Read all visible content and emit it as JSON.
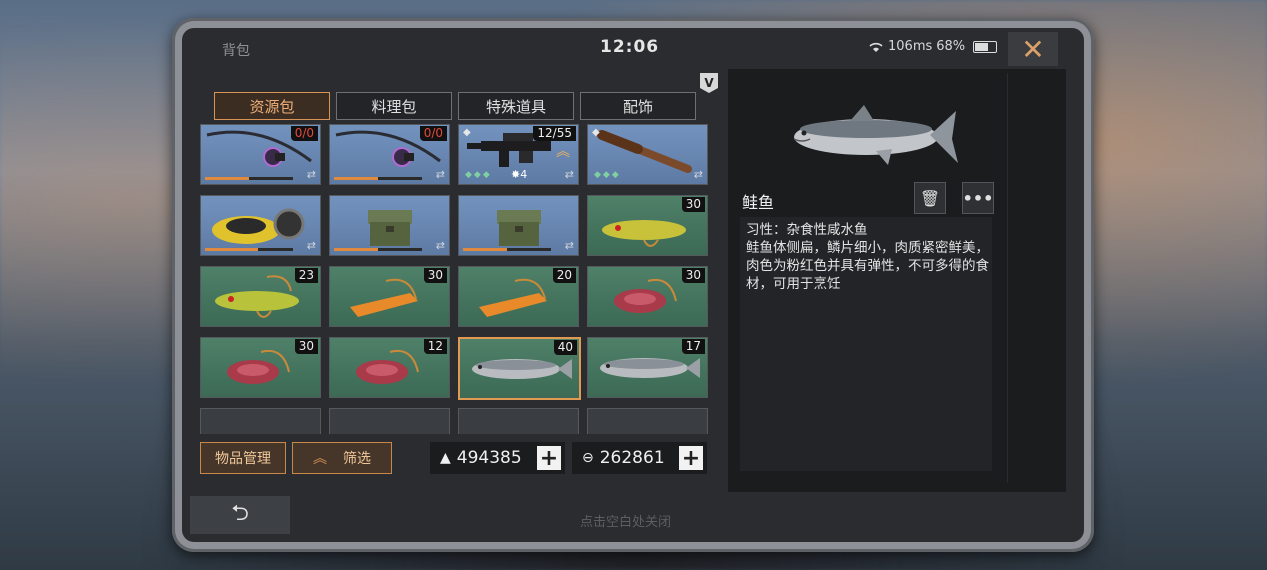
{
  "status": {
    "title": "背包",
    "clock": "12:06",
    "ping": "106ms",
    "battery": "68%"
  },
  "tabs": [
    {
      "label": "资源包",
      "active": true
    },
    {
      "label": "料理包",
      "active": false
    },
    {
      "label": "特殊道具",
      "active": false
    },
    {
      "label": "配饰",
      "active": false
    }
  ],
  "items": [
    {
      "icon": "fishing-rod-icon",
      "count": "0/0",
      "red": true,
      "style": "blue",
      "durability": 0.5
    },
    {
      "icon": "fishing-rod-icon",
      "count": "0/0",
      "red": true,
      "style": "blue",
      "durability": 0.5
    },
    {
      "icon": "rifle-icon",
      "count": "12/55",
      "style": "blue",
      "stars": "4"
    },
    {
      "icon": "bat-icon",
      "style": "blue"
    },
    {
      "icon": "drone-icon",
      "style": "blue",
      "durability": 0.6
    },
    {
      "icon": "crate-icon",
      "style": "blue",
      "durability": 0.5
    },
    {
      "icon": "crate-icon",
      "style": "blue",
      "durability": 0.5
    },
    {
      "icon": "lure-green-icon",
      "count": "30",
      "style": "green"
    },
    {
      "icon": "lure-green-icon",
      "count": "23",
      "style": "green"
    },
    {
      "icon": "bait-orange-icon",
      "count": "30",
      "style": "green"
    },
    {
      "icon": "bait-orange-icon",
      "count": "20",
      "style": "green"
    },
    {
      "icon": "bait-meat-icon",
      "count": "30",
      "style": "green"
    },
    {
      "icon": "bait-meat-icon",
      "count": "30",
      "style": "green"
    },
    {
      "icon": "bait-meat-icon",
      "count": "12",
      "style": "green"
    },
    {
      "icon": "salmon-icon",
      "count": "40",
      "style": "green",
      "selected": true
    },
    {
      "icon": "salmon-icon",
      "count": "17",
      "style": "green"
    }
  ],
  "buttons": {
    "manage": "物品管理",
    "filter": "筛选"
  },
  "currency": {
    "coins": "494385",
    "gold": "262861"
  },
  "hint": "点击空白处关闭",
  "detail": {
    "name": "鲑鱼",
    "habit": "习性：杂食性咸水鱼",
    "description": "鲑鱼体侧扁，鳞片细小，肉质紧密鲜美，肉色为粉红色并具有弹性，不可多得的食材，可用于烹饪"
  },
  "colors": {
    "accent": "#d89456",
    "slot_blue": "#6688b4",
    "slot_green": "#467459"
  }
}
